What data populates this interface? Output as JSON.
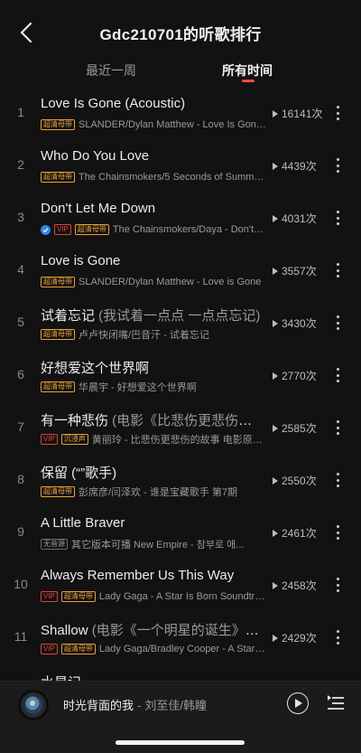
{
  "header": {
    "title": "Gdc210701的听歌排行"
  },
  "tabs": [
    {
      "label": "最近一周",
      "active": false
    },
    {
      "label": "所有时间",
      "active": true
    }
  ],
  "accent_color": "#ef4a3c",
  "songs": [
    {
      "rank": "1",
      "title": "Love Is Gone (Acoustic)",
      "subtitle": "",
      "tags": [
        {
          "label": "超清母带",
          "color": "orange"
        }
      ],
      "verified": false,
      "artist": "SLANDER/Dylan Matthew - Love Is Gone (Acoustic)",
      "plays": "16141次"
    },
    {
      "rank": "2",
      "title": "Who Do You Love",
      "subtitle": "",
      "tags": [
        {
          "label": "超清母带",
          "color": "orange"
        }
      ],
      "verified": false,
      "artist": "The Chainsmokers/5 Seconds of Summer - Who Do You Love",
      "plays": "4439次"
    },
    {
      "rank": "3",
      "title": "Don't Let Me Down",
      "subtitle": "",
      "tags": [
        {
          "label": "VIP",
          "color": "red"
        },
        {
          "label": "超清母带",
          "color": "orange"
        }
      ],
      "verified": true,
      "artist": "The Chainsmokers/Daya - Don't Let Me Down",
      "plays": "4031次"
    },
    {
      "rank": "4",
      "title": "Love is Gone",
      "subtitle": "",
      "tags": [
        {
          "label": "超清母带",
          "color": "orange"
        }
      ],
      "verified": false,
      "artist": "SLANDER/Dylan Matthew - Love is Gone",
      "plays": "3557次"
    },
    {
      "rank": "5",
      "title": "试着忘记",
      "subtitle": " (我试着一点点 一点点忘记)",
      "tags": [
        {
          "label": "超清母带",
          "color": "orange"
        }
      ],
      "verified": false,
      "artist": "卢卢快闭嘴/巴音汗 - 试着忘记",
      "plays": "3430次"
    },
    {
      "rank": "6",
      "title": "好想爱这个世界啊",
      "subtitle": "",
      "tags": [
        {
          "label": "超清母带",
          "color": "orange"
        }
      ],
      "verified": false,
      "artist": "华晨宇 - 好想爱这个世界啊",
      "plays": "2770次"
    },
    {
      "rank": "7",
      "title": "有一种悲伤",
      "subtitle": " (电影《比悲伤更悲伤的故事》主题曲)",
      "tags": [
        {
          "label": "VIP",
          "color": "red"
        },
        {
          "label": "沉浸声",
          "color": "orange"
        }
      ],
      "verified": false,
      "artist": "黄丽玲 - 比悲伤更悲伤的故事 电影原声带",
      "plays": "2585次"
    },
    {
      "rank": "8",
      "title": "保留 (“”歌手)",
      "subtitle": "",
      "tags": [
        {
          "label": "超清母带",
          "color": "orange"
        }
      ],
      "verified": false,
      "artist": "彭席彦/闫泽欢 - 谁是宝藏歌手 第7期",
      "plays": "2550次"
    },
    {
      "rank": "9",
      "title": "A Little Braver",
      "subtitle": "",
      "tags": [
        {
          "label": "无音源",
          "color": "gray"
        }
      ],
      "verified": false,
      "artist": "其它版本可播   New Empire - 참부로 애...",
      "plays": "2461次"
    },
    {
      "rank": "10",
      "title": "Always Remember Us This Way",
      "subtitle": "",
      "tags": [
        {
          "label": "VIP",
          "color": "red"
        },
        {
          "label": "超清母带",
          "color": "orange"
        }
      ],
      "verified": false,
      "artist": "Lady Gaga - A Star Is Born Soundtrack",
      "plays": "2458次"
    },
    {
      "rank": "11",
      "title": "Shallow",
      "subtitle": " (电影《一个明星的诞生》主题曲)",
      "tags": [
        {
          "label": "VIP",
          "color": "red"
        },
        {
          "label": "超清母带",
          "color": "orange"
        }
      ],
      "verified": false,
      "artist": "Lady Gaga/Bradley Cooper - A Star Is Born",
      "plays": "2429次"
    },
    {
      "rank": "12",
      "title": "水星记",
      "subtitle": "",
      "tags": [],
      "verified": false,
      "artist": "",
      "plays": ""
    }
  ],
  "player": {
    "song": "时光背面的我",
    "separator": "-",
    "artist": "刘至佳/韩瞳"
  }
}
